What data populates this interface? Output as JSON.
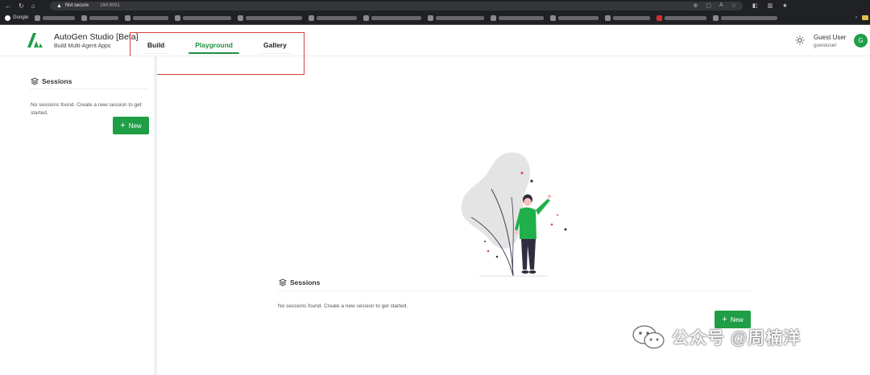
{
  "browser": {
    "security_label": "Not secure",
    "url": "184:8081",
    "bookmarks": [
      "Google"
    ]
  },
  "header": {
    "title": "AutoGen Studio [Beta]",
    "subtitle": "Build Multi-Agent Apps",
    "tabs": [
      {
        "label": "Build",
        "active": false
      },
      {
        "label": "Playground",
        "active": true
      },
      {
        "label": "Gallery",
        "active": false
      }
    ],
    "user": {
      "name": "Guest User",
      "id": "guestuser",
      "initial": "G"
    }
  },
  "sidebar": {
    "heading": "Sessions",
    "empty_text": "No sessions found. Create a new session to get started.",
    "new_button": "New"
  },
  "main": {
    "heading": "Sessions",
    "empty_text": "No sessions found. Create a new session to get started.",
    "new_button": "New"
  },
  "watermark": {
    "text": "公众号 @周楠洋"
  },
  "colors": {
    "accent": "#1f9e46",
    "highlight_box": "#d9413a"
  },
  "icons": [
    "back-icon",
    "reload-icon",
    "home-icon",
    "warning-icon",
    "sun-icon",
    "sessions-icon",
    "plus-icon",
    "wechat-icon"
  ]
}
